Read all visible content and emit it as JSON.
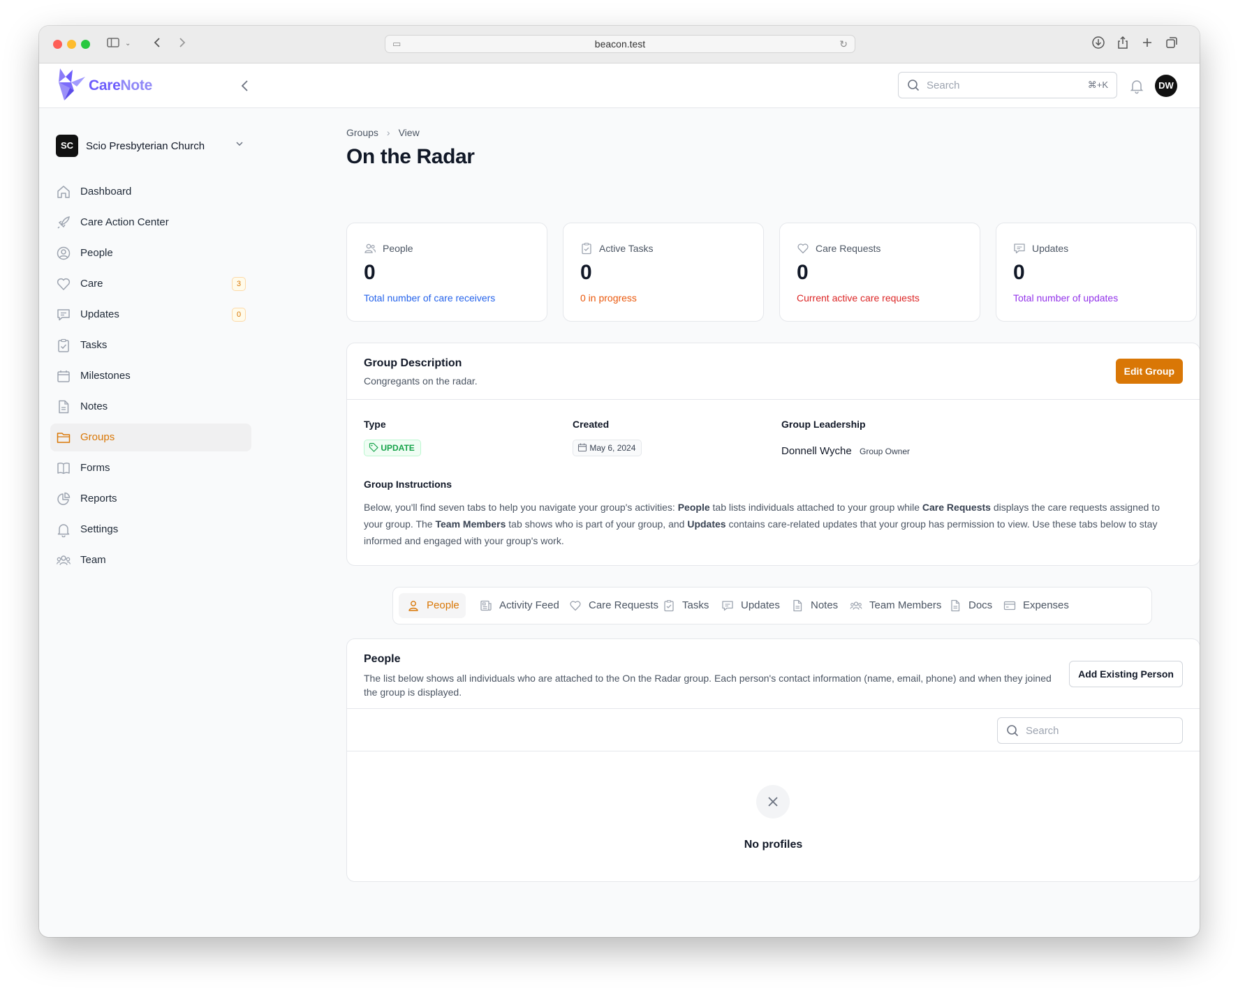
{
  "browser": {
    "url": "beacon.test"
  },
  "app": {
    "brand_part1": "Care",
    "brand_part2": "Note",
    "search_placeholder": "Search",
    "search_shortcut": "⌘+K",
    "user_initials": "DW"
  },
  "sidebar": {
    "org_initials": "SC",
    "org_name": "Scio Presbyterian Church",
    "items": [
      {
        "label": "Dashboard",
        "icon": "home-icon"
      },
      {
        "label": "Care Action Center",
        "icon": "rocket-icon"
      },
      {
        "label": "People",
        "icon": "user-circle-icon"
      },
      {
        "label": "Care",
        "icon": "heart-icon",
        "badge": "3"
      },
      {
        "label": "Updates",
        "icon": "chat-icon",
        "badge": "0"
      },
      {
        "label": "Tasks",
        "icon": "clipboard-icon"
      },
      {
        "label": "Milestones",
        "icon": "calendar-icon"
      },
      {
        "label": "Notes",
        "icon": "document-icon"
      },
      {
        "label": "Groups",
        "icon": "folder-icon",
        "active": true
      },
      {
        "label": "Forms",
        "icon": "book-icon"
      },
      {
        "label": "Reports",
        "icon": "pie-chart-icon"
      },
      {
        "label": "Settings",
        "icon": "bell-icon"
      },
      {
        "label": "Team",
        "icon": "users-icon"
      }
    ]
  },
  "breadcrumb": {
    "groups": "Groups",
    "view": "View"
  },
  "page_title": "On the Radar",
  "stats": [
    {
      "label": "People",
      "value": "0",
      "sub": "Total number of care receivers",
      "color": "#2563eb"
    },
    {
      "label": "Active Tasks",
      "value": "0",
      "sub": "0 in progress",
      "color": "#ea580c"
    },
    {
      "label": "Care Requests",
      "value": "0",
      "sub": "Current active care requests",
      "color": "#dc2626"
    },
    {
      "label": "Updates",
      "value": "0",
      "sub": "Total number of updates",
      "color": "#9333ea"
    }
  ],
  "description": {
    "title": "Group Description",
    "text": "Congregants on the radar.",
    "edit_label": "Edit Group",
    "type_label": "Type",
    "type_value": "UPDATE",
    "created_label": "Created",
    "created_value": "May 6, 2024",
    "leadership_label": "Group Leadership",
    "leader_name": "Donnell Wyche",
    "leader_role": "Group Owner",
    "instructions_label": "Group Instructions",
    "instr_1": "Below, you'll find seven tabs to help you navigate your group's activities: ",
    "instr_people": "People",
    "instr_2": " tab lists individuals attached to your group while ",
    "instr_care": "Care Requests",
    "instr_3": " displays the care requests assigned to your group. The ",
    "instr_team": "Team Members",
    "instr_4": " tab shows who is part of your group, and ",
    "instr_updates": "Updates",
    "instr_5": " contains care-related updates that your group has permission to view. Use these tabs below to stay informed and engaged with your group's work."
  },
  "tabs": [
    {
      "label": "People",
      "active": true
    },
    {
      "label": "Activity Feed"
    },
    {
      "label": "Care Requests"
    },
    {
      "label": "Tasks"
    },
    {
      "label": "Updates"
    },
    {
      "label": "Notes"
    },
    {
      "label": "Team Members"
    },
    {
      "label": "Docs"
    },
    {
      "label": "Expenses"
    }
  ],
  "people_panel": {
    "title": "People",
    "text": "The list below shows all individuals who are attached to the On the Radar group. Each person's contact information (name, email, phone) and when they joined the group is displayed.",
    "add_label": "Add Existing Person",
    "search_placeholder": "Search",
    "empty_text": "No profiles"
  }
}
